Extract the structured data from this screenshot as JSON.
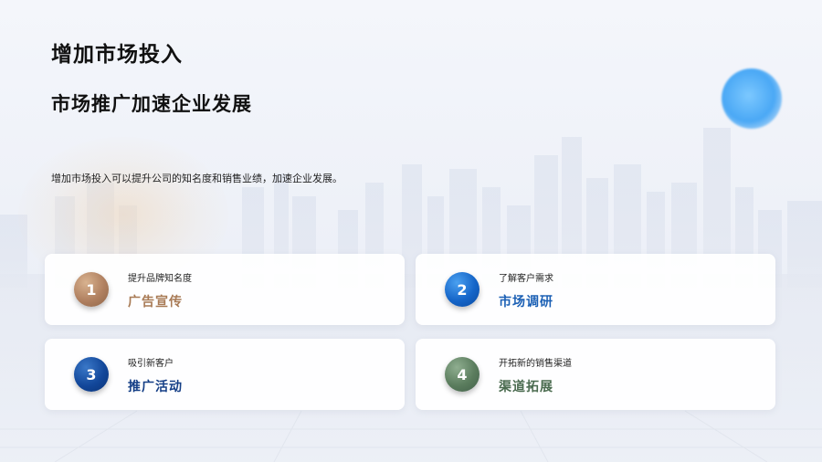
{
  "title": "增加市场投入",
  "subtitle": "市场推广加速企业发展",
  "description": "增加市场投入可以提升公司的知名度和销售业绩，加速企业发展。",
  "cards": [
    {
      "number": "1",
      "label": "提升品牌知名度",
      "value": "广告宣传",
      "value_color": "#a87a55",
      "badge_color": "#b08060"
    },
    {
      "number": "2",
      "label": "了解客户需求",
      "value": "市场调研",
      "value_color": "#1a5fb4",
      "badge_color": "#1565c8"
    },
    {
      "number": "3",
      "label": "吸引新客户",
      "value": "推广活动",
      "value_color": "#143e86",
      "badge_color": "#12479a"
    },
    {
      "number": "4",
      "label": "开拓新的销售渠道",
      "value": "渠道拓展",
      "value_color": "#4a6b4f",
      "badge_color": "#5a7c5d"
    }
  ]
}
